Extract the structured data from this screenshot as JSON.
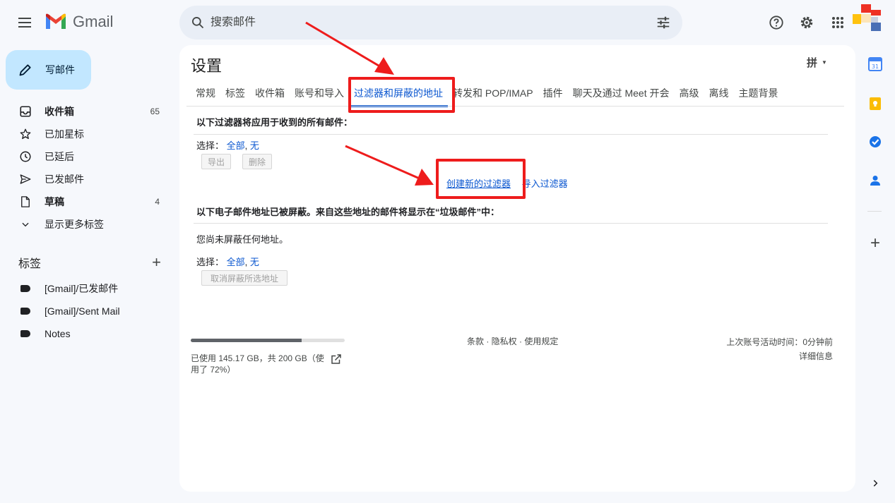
{
  "header": {
    "app_name": "Gmail",
    "search_placeholder": "搜索邮件"
  },
  "sidebar": {
    "compose_label": "写邮件",
    "items": [
      {
        "label": "收件箱",
        "count": "65"
      },
      {
        "label": "已加星标",
        "count": ""
      },
      {
        "label": "已延后",
        "count": ""
      },
      {
        "label": "已发邮件",
        "count": ""
      },
      {
        "label": "草稿",
        "count": "4"
      },
      {
        "label": "显示更多标签",
        "count": ""
      }
    ],
    "labels_title": "标签",
    "labels": [
      "[Gmail]/已发邮件",
      "[Gmail]/Sent Mail",
      "Notes"
    ]
  },
  "settings": {
    "title": "设置",
    "ime_indicator": "拼",
    "tabs": [
      "常规",
      "标签",
      "收件箱",
      "账号和导入",
      "过滤器和屏蔽的地址",
      "转发和 POP/IMAP",
      "插件",
      "聊天及通过 Meet 开会",
      "高级",
      "离线",
      "主题背景"
    ],
    "active_tab": "过滤器和屏蔽的地址",
    "filters": {
      "heading": "以下过滤器将应用于收到的所有邮件：",
      "select_label": "选择：",
      "select_all": "全部",
      "select_sep": ",",
      "select_none": "无",
      "export_button": "导出",
      "delete_button": "删除",
      "create_link": "创建新的过滤器",
      "import_link": "导入过滤器"
    },
    "blocked": {
      "heading": "以下电子邮件地址已被屏蔽。来自这些地址的邮件将显示在“垃圾邮件”中：",
      "empty_text": "您尚未屏蔽任何地址。",
      "select_label": "选择：",
      "select_all": "全部",
      "select_sep": ",",
      "select_none": "无",
      "unblock_button": "取消屏蔽所选地址"
    }
  },
  "footer": {
    "storage_text": "已使用 145.17 GB，共 200 GB（使用了 72%）",
    "storage_fraction": 0.72,
    "links": "条款 · 隐私权 · 使用规定",
    "last_activity": "上次账号活动时间：0分钟前",
    "details": "详细信息"
  },
  "colors": {
    "accent": "#0b57d0",
    "highlight": "#ee1c1c",
    "compose_bg": "#c2e7ff"
  }
}
